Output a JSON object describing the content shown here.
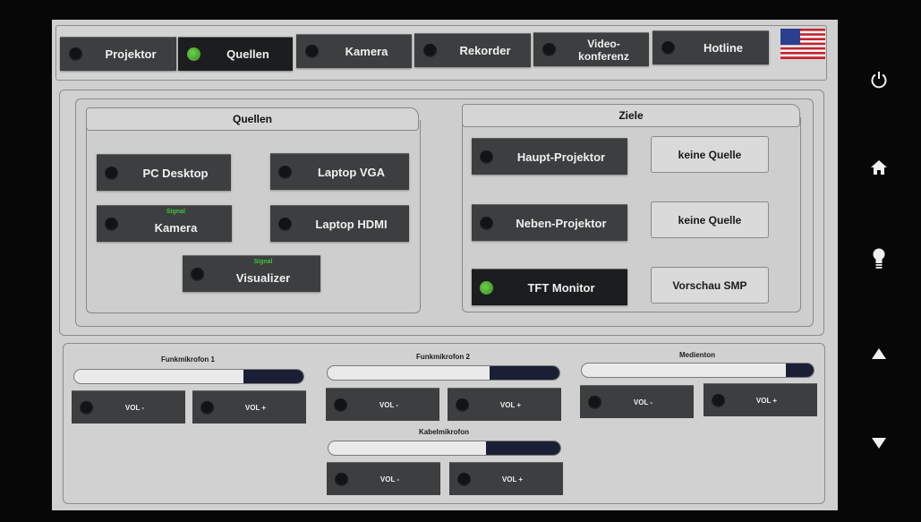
{
  "nav": {
    "tabs": [
      {
        "label": "Projektor",
        "active": false,
        "indicator": "off"
      },
      {
        "label": "Quellen",
        "active": true,
        "indicator": "on"
      },
      {
        "label": "Kamera",
        "active": false,
        "indicator": "off"
      },
      {
        "label": "Rekorder",
        "active": false,
        "indicator": "off"
      },
      {
        "label": "Video-\nkonferenz",
        "active": false,
        "indicator": "off"
      },
      {
        "label": "Hotline",
        "active": false,
        "indicator": "off"
      }
    ],
    "language_flag": "us-flag-icon"
  },
  "sources": {
    "title": "Quellen",
    "buttons": [
      {
        "label": "PC Desktop",
        "signal": ""
      },
      {
        "label": "Laptop VGA",
        "signal": ""
      },
      {
        "label": "Kamera",
        "signal": "Signal"
      },
      {
        "label": "Laptop HDMI",
        "signal": ""
      },
      {
        "label": "Visualizer",
        "signal": "Signal"
      }
    ]
  },
  "targets": {
    "title": "Ziele",
    "rows": [
      {
        "label": "Haupt-Projektor",
        "output": "keine Quelle",
        "indicator": "off"
      },
      {
        "label": "Neben-Projektor",
        "output": "keine Quelle",
        "indicator": "off"
      },
      {
        "label": "TFT Monitor",
        "output": "Vorschau SMP",
        "indicator": "on"
      }
    ]
  },
  "audio": {
    "channels": [
      {
        "label": "Funkmikrofon 1",
        "level": 0.74,
        "vol_minus": "VOL -",
        "vol_plus": "VOL +"
      },
      {
        "label": "Funkmikrofon 2",
        "level": 0.7,
        "vol_minus": "VOL -",
        "vol_plus": "VOL +"
      },
      {
        "label": "Medienton",
        "level": 0.88,
        "vol_minus": "VOL -",
        "vol_plus": "VOL +"
      },
      {
        "label": "Kabelmikrofon",
        "level": 0.68,
        "vol_minus": "VOL -",
        "vol_plus": "VOL +"
      }
    ]
  },
  "hardware_keys": [
    "power-icon",
    "home-icon",
    "light-bulb-icon",
    "arrow-up-icon",
    "arrow-down-icon"
  ],
  "colors": {
    "indicator_on": "#4fb83a",
    "button": "#3d3e3f",
    "panel": "#d0d1d0"
  }
}
